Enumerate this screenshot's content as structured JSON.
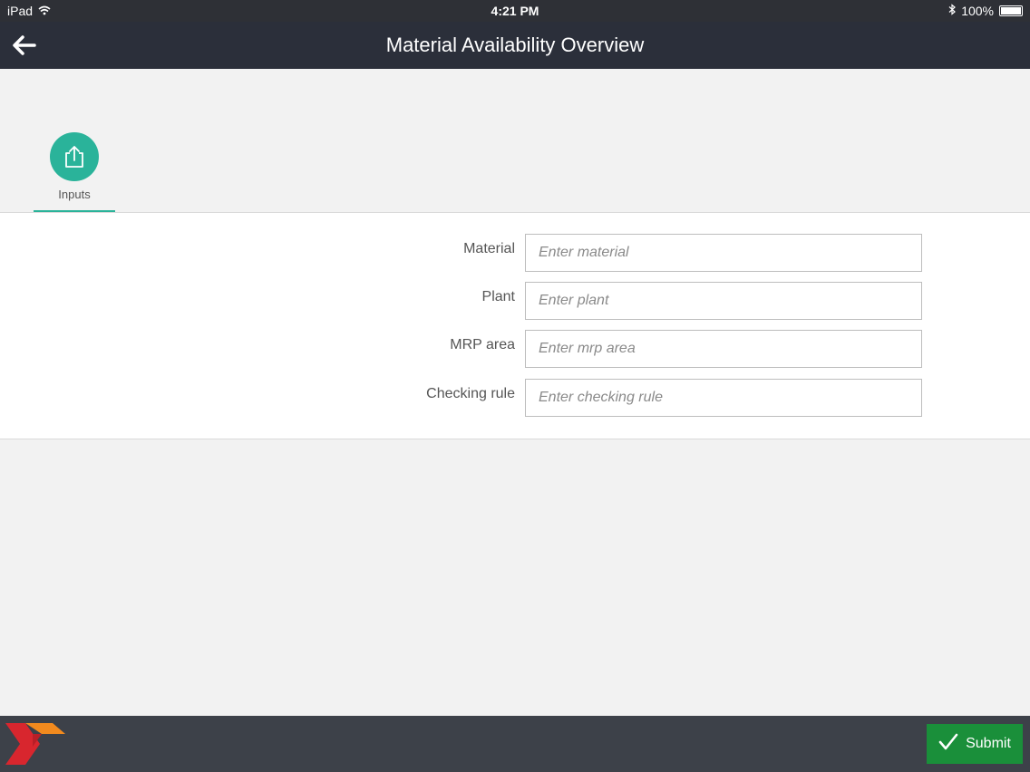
{
  "statusbar": {
    "device": "iPad",
    "time": "4:21 PM",
    "battery": "100%",
    "icons": [
      "wifi-icon",
      "bluetooth-icon",
      "battery-icon"
    ]
  },
  "navbar": {
    "title": "Material Availability Overview",
    "back_icon": "back-arrow-icon"
  },
  "tabs": [
    {
      "label": "Inputs",
      "icon": "share-upload-icon",
      "active": true
    }
  ],
  "form": {
    "fields": [
      {
        "label": "Material",
        "placeholder": "Enter material",
        "value": ""
      },
      {
        "label": "Plant",
        "placeholder": "Enter plant",
        "value": ""
      },
      {
        "label": "MRP area",
        "placeholder": "Enter mrp area",
        "value": ""
      },
      {
        "label": "Checking rule",
        "placeholder": "Enter checking rule",
        "value": ""
      }
    ]
  },
  "footer": {
    "submit_label": "Submit",
    "submit_icon": "checkmark-icon",
    "logo": "brand-logo"
  },
  "colors": {
    "accent": "#2ab39a",
    "navbar": "#2b2f3a",
    "footer": "#3d4149",
    "submit": "#1a8f3a"
  }
}
